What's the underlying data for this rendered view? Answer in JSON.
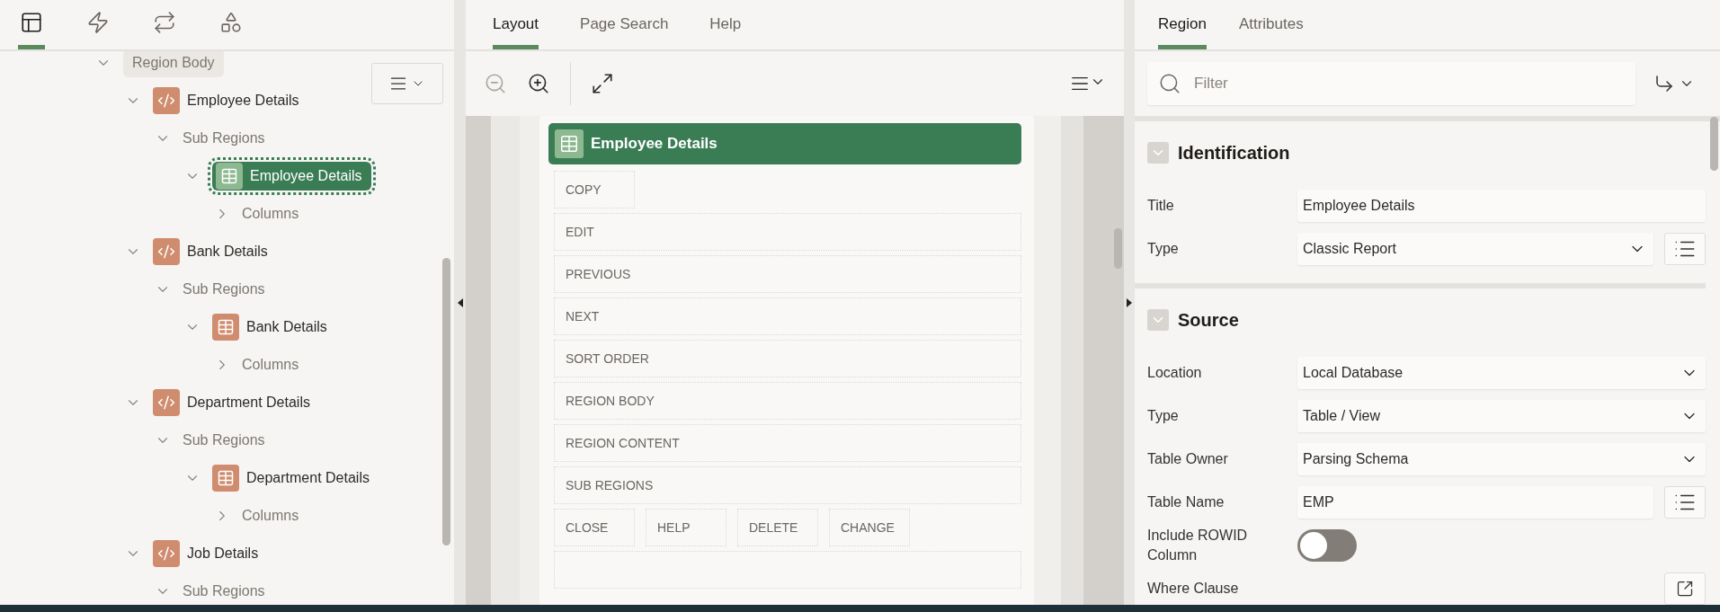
{
  "left_panel": {
    "tabs": [
      {
        "selected": true
      },
      {
        "selected": false
      },
      {
        "selected": false
      },
      {
        "selected": false
      }
    ],
    "tree": [
      {
        "label": "Region Body",
        "kind": "group",
        "expanded": true,
        "selected": false,
        "children": [
          {
            "label": "Employee Details",
            "kind": "region",
            "expanded": true,
            "selected": false,
            "children": [
              {
                "label": "Sub Regions",
                "kind": "folder",
                "expanded": true,
                "selected": false,
                "children": [
                  {
                    "label": "Employee Details",
                    "kind": "table",
                    "expanded": true,
                    "selected": true,
                    "children": [
                      {
                        "label": "Columns",
                        "kind": "folder",
                        "expanded": false,
                        "selected": false
                      }
                    ]
                  }
                ]
              }
            ]
          },
          {
            "label": "Bank Details",
            "kind": "region",
            "expanded": true,
            "selected": false,
            "children": [
              {
                "label": "Sub Regions",
                "kind": "folder",
                "expanded": true,
                "selected": false,
                "children": [
                  {
                    "label": "Bank Details",
                    "kind": "table",
                    "expanded": true,
                    "selected": false,
                    "children": [
                      {
                        "label": "Columns",
                        "kind": "folder",
                        "expanded": false,
                        "selected": false
                      }
                    ]
                  }
                ]
              }
            ]
          },
          {
            "label": "Department Details",
            "kind": "region",
            "expanded": true,
            "selected": false,
            "children": [
              {
                "label": "Sub Regions",
                "kind": "folder",
                "expanded": true,
                "selected": false,
                "children": [
                  {
                    "label": "Department Details",
                    "kind": "table",
                    "expanded": true,
                    "selected": false,
                    "children": [
                      {
                        "label": "Columns",
                        "kind": "folder",
                        "expanded": false,
                        "selected": false
                      }
                    ]
                  }
                ]
              }
            ]
          },
          {
            "label": "Job Details",
            "kind": "region",
            "expanded": true,
            "selected": false,
            "children": [
              {
                "label": "Sub Regions",
                "kind": "folder",
                "expanded": true,
                "selected": false
              }
            ]
          }
        ]
      }
    ]
  },
  "center_panel": {
    "tabs": [
      {
        "label": "Layout",
        "selected": true
      },
      {
        "label": "Page Search",
        "selected": false
      },
      {
        "label": "Help",
        "selected": false
      }
    ],
    "toolbar": [
      {
        "kind": "zoom-out",
        "disabled": true
      },
      {
        "kind": "zoom-in",
        "disabled": false
      },
      {
        "kind": "expand",
        "disabled": false
      }
    ],
    "region_title": "Employee Details",
    "positions": [
      {
        "kind": "slot",
        "labels": [
          "COPY"
        ]
      },
      {
        "kind": "wide",
        "labels": [
          "EDIT"
        ]
      },
      {
        "kind": "wide",
        "labels": [
          "PREVIOUS"
        ]
      },
      {
        "kind": "wide",
        "labels": [
          "NEXT"
        ]
      },
      {
        "kind": "wide",
        "labels": [
          "SORT ORDER"
        ]
      },
      {
        "kind": "wide",
        "labels": [
          "REGION BODY"
        ]
      },
      {
        "kind": "wide",
        "labels": [
          "REGION CONTENT"
        ]
      },
      {
        "kind": "wide",
        "labels": [
          "SUB REGIONS"
        ]
      },
      {
        "kind": "slot",
        "labels": [
          "CLOSE",
          "HELP",
          "DELETE",
          "CHANGE"
        ]
      }
    ]
  },
  "right_panel": {
    "tabs": [
      {
        "label": "Region",
        "selected": true
      },
      {
        "label": "Attributes",
        "selected": false
      }
    ],
    "filter": {
      "placeholder": "Filter"
    },
    "sections": [
      {
        "title": "Identification",
        "expanded": true,
        "fields": [
          {
            "label": "Title",
            "kind": "text",
            "value": "Employee Details"
          },
          {
            "label": "Type",
            "kind": "select",
            "value": "Classic Report",
            "list_button": true
          }
        ]
      },
      {
        "title": "Source",
        "expanded": true,
        "fields": [
          {
            "label": "Location",
            "kind": "select",
            "value": "Local Database"
          },
          {
            "label": "Type",
            "kind": "select",
            "value": "Table / View"
          },
          {
            "label": "Table Owner",
            "kind": "select",
            "value": "Parsing Schema"
          },
          {
            "label": "Table Name",
            "kind": "text",
            "value": "EMP",
            "list_button": true
          },
          {
            "label": "Include ROWID Column",
            "kind": "switch",
            "on": false
          },
          {
            "label": "Where Clause",
            "kind": "code"
          }
        ]
      }
    ]
  }
}
